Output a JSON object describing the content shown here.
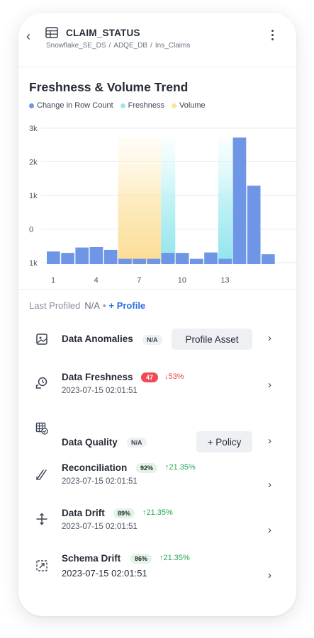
{
  "header": {
    "title": "CLAIM_STATUS",
    "breadcrumb": [
      "Snowflake_SE_DS",
      "ADQE_DB",
      "Ins_Claims"
    ],
    "breadcrumb_sep": "/"
  },
  "chart_data": {
    "type": "bar",
    "title": "Freshness & Volume Trend",
    "legend": [
      {
        "label": "Change in Row Count",
        "color": "#6f96e6"
      },
      {
        "label": "Freshness",
        "color": "#9ee6ee"
      },
      {
        "label": "Volume",
        "color": "#fbe2a2"
      }
    ],
    "y_ticks": [
      {
        "label": "3k",
        "value": 3000
      },
      {
        "label": "2k",
        "value": 2000
      },
      {
        "label": "1k",
        "value": 1000
      },
      {
        "label": "0",
        "value": 0
      },
      {
        "label": "1k",
        "value": -1000
      }
    ],
    "ylim": [
      -1000,
      3000
    ],
    "x_ticks": [
      1,
      4,
      7,
      10,
      13
    ],
    "bars": [
      {
        "x": 1,
        "value": -780
      },
      {
        "x": 2,
        "value": -850
      },
      {
        "x": 3,
        "value": -580
      },
      {
        "x": 4,
        "value": -560
      },
      {
        "x": 5,
        "value": -700
      },
      {
        "x": 6,
        "value": -1150
      },
      {
        "x": 7,
        "value": -1150
      },
      {
        "x": 8,
        "value": -1150
      },
      {
        "x": 9,
        "value": -850
      },
      {
        "x": 10,
        "value": -850
      },
      {
        "x": 11,
        "value": -1150
      },
      {
        "x": 12,
        "value": -830
      },
      {
        "x": 13,
        "value": -1150
      },
      {
        "x": 14,
        "value": 2720
      },
      {
        "x": 15,
        "value": 1290
      },
      {
        "x": 16,
        "value": -920
      }
    ],
    "highlights": [
      {
        "from": 6,
        "to": 8,
        "series": "Volume"
      },
      {
        "from": 9,
        "to": 9,
        "series": "Freshness"
      },
      {
        "from": 13,
        "to": 13,
        "series": "Freshness"
      }
    ]
  },
  "profile": {
    "label": "Last Profiled",
    "value": "N/A",
    "bullet": "•",
    "link": "+ Profile"
  },
  "rows": [
    {
      "name": "Data Anomalies",
      "tag": "N/A",
      "button": "Profile Asset",
      "icon": "image-icon"
    },
    {
      "name": "Data Freshness",
      "tag": "47",
      "delta": "↓53%",
      "timestamp": "2023-07-15 02:01:51",
      "icon": "clock-icon"
    },
    {
      "name": "Data Quality",
      "tag": "N/A",
      "button": "+ Policy",
      "icon": "grid-check-icon"
    },
    {
      "name": "Reconciliation",
      "tag": "92%",
      "delta": "↑21.35%",
      "timestamp": "2023-07-15 02:01:51",
      "icon": "reconcile-icon"
    },
    {
      "name": "Data Drift",
      "tag": "89%",
      "delta": "↑21.35%",
      "timestamp": "2023-07-15 02:01:51",
      "icon": "drift-icon"
    },
    {
      "name": "Schema Drift",
      "tag": "86%",
      "delta": "↑21.35%",
      "timestamp": "2023-07-15 02:01:51",
      "icon": "schema-drift-icon"
    }
  ],
  "chevron": "›",
  "back_icon": "‹"
}
